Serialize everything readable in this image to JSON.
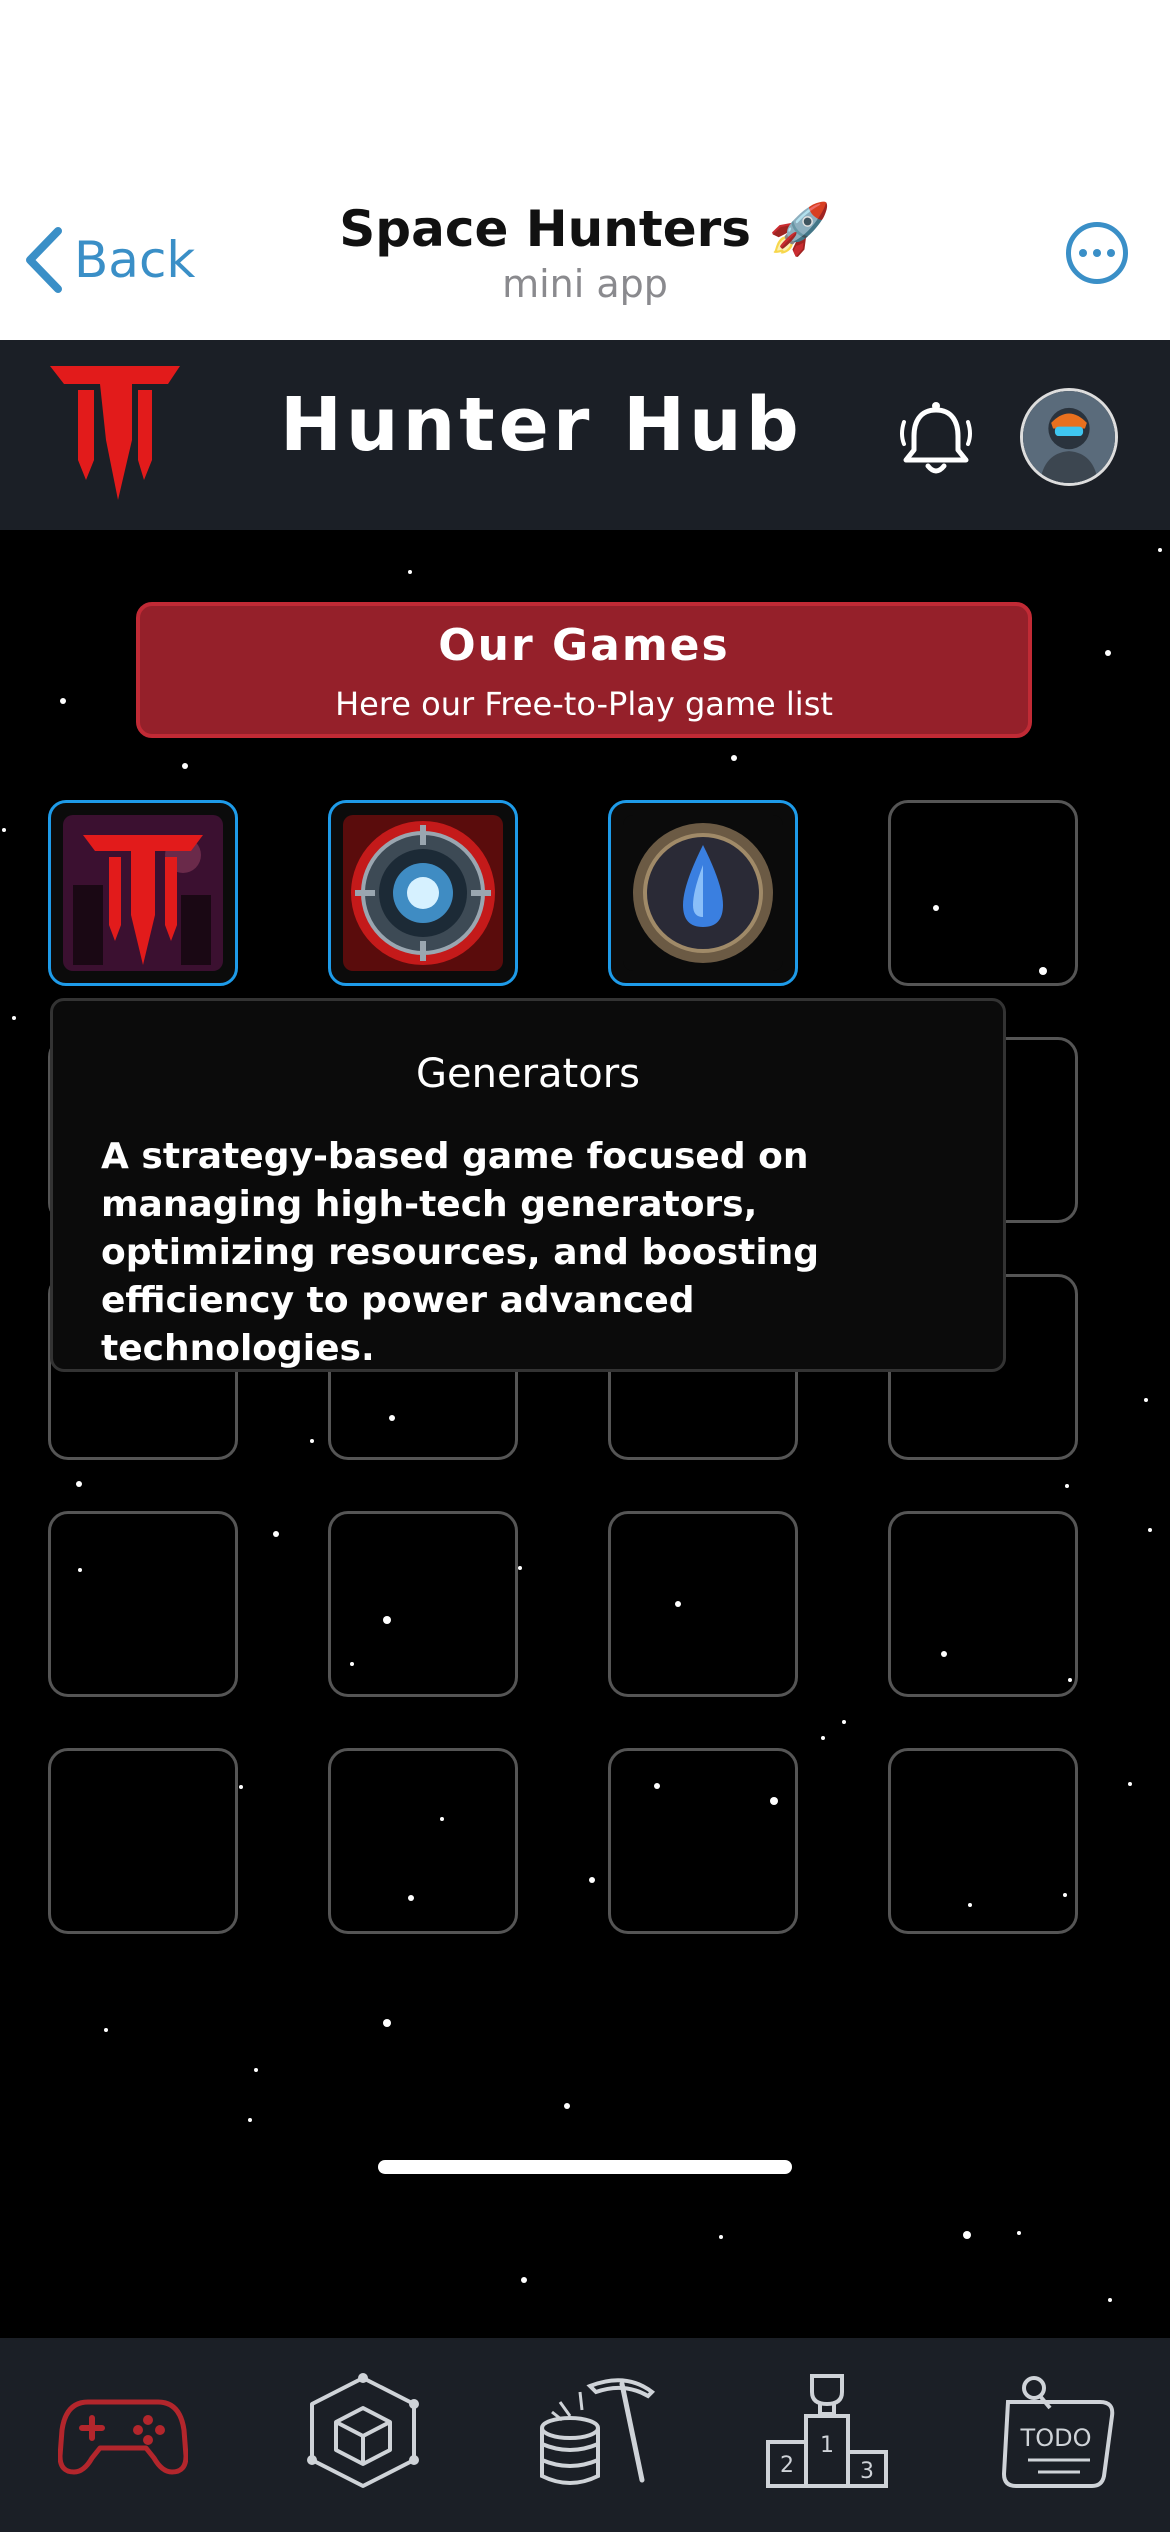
{
  "telegram": {
    "back_label": "Back",
    "title": "Space Hunters 🚀",
    "subtitle": "mini app"
  },
  "app_bar": {
    "title": "Hunter Hub"
  },
  "banner": {
    "title": "Our Games",
    "subtitle": "Here our Free-to-Play game list"
  },
  "games": [
    {
      "name": "space-hunters-game",
      "icon": "hunter-logo-icon"
    },
    {
      "name": "generators-game",
      "icon": "energy-core-icon"
    },
    {
      "name": "alchemy-game",
      "icon": "potion-drop-icon"
    }
  ],
  "tooltip": {
    "title": "Generators",
    "description": "A strategy-based game focused on managing high-tech generators, optimizing resources, and boosting efficiency to power advanced technologies."
  },
  "bottom_nav": [
    {
      "icon": "gamepad-icon",
      "active": true
    },
    {
      "icon": "cube-icon",
      "active": false
    },
    {
      "icon": "mining-icon",
      "active": false
    },
    {
      "icon": "leaderboard-icon",
      "active": false
    },
    {
      "icon": "todo-icon",
      "active": false
    }
  ],
  "colors": {
    "accent_red": "#e21b1b",
    "banner_red": "#95202a",
    "tile_border_active": "#1e9be9",
    "telegram_blue": "#3a8fc7"
  }
}
